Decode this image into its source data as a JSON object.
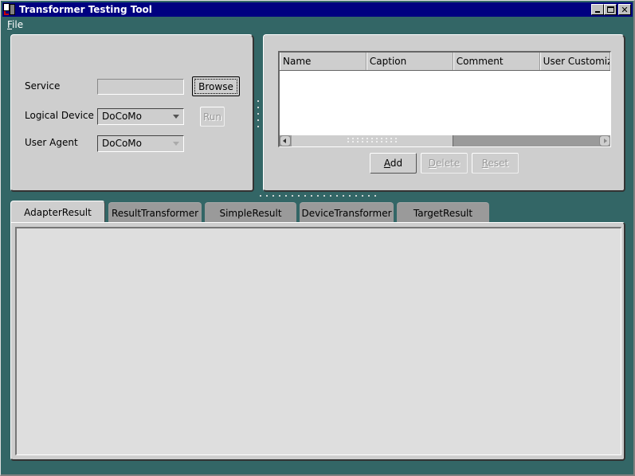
{
  "window": {
    "title": "Transformer Testing Tool",
    "controls": [
      "minimize",
      "maximize",
      "close"
    ]
  },
  "menubar": {
    "items": [
      {
        "label": "File",
        "mnemonic": "F"
      }
    ]
  },
  "form": {
    "service": {
      "label": "Service",
      "value": "",
      "browse_label": "Browse"
    },
    "logical_device": {
      "label": "Logical Device",
      "value": "DoCoMo",
      "run_label": "Run"
    },
    "user_agent": {
      "label": "User Agent",
      "value": "DoCoMo"
    }
  },
  "table": {
    "columns": [
      "Name",
      "Caption",
      "Comment",
      "User Customiz"
    ],
    "rows": []
  },
  "actions": {
    "add": {
      "label_rest": "dd",
      "mnemonic": "A",
      "enabled": true
    },
    "delete": {
      "label_rest": "elete",
      "mnemonic": "D",
      "enabled": false
    },
    "reset": {
      "label_rest": "eset",
      "mnemonic": "R",
      "enabled": false
    }
  },
  "tabs": [
    {
      "label": "AdapterResult",
      "active": true
    },
    {
      "label": "ResultTransformer",
      "active": false
    },
    {
      "label": "SimpleResult",
      "active": false
    },
    {
      "label": "DeviceTransformer",
      "active": false
    },
    {
      "label": "TargetResult",
      "active": false
    }
  ],
  "colors": {
    "background": "#336666",
    "titlebar": "#000080",
    "panel": "#cecece",
    "tab_inactive": "#9a9a9a"
  }
}
